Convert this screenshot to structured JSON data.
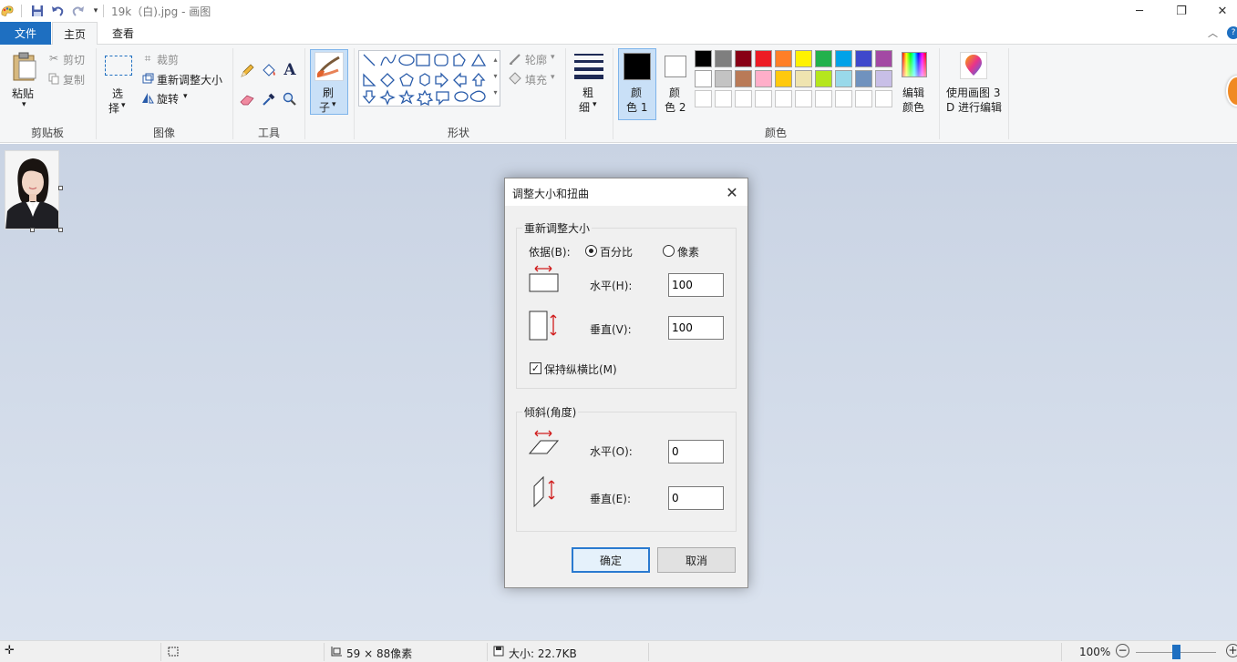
{
  "titlebar": {
    "title": "19k（白).jpg - 画图",
    "icons": [
      "paint-app-icon",
      "save-icon",
      "undo-icon",
      "redo-icon",
      "customize-qat-icon"
    ],
    "controls": {
      "minimize": "─",
      "maximize": "❐",
      "close": "✕"
    }
  },
  "tabs": {
    "file": "文件",
    "home": "主页",
    "view": "查看"
  },
  "ribbon": {
    "clipboard": {
      "paste": "粘贴",
      "cut": "剪切",
      "copy": "复制",
      "group": "剪贴板"
    },
    "image": {
      "select_line1": "选",
      "select_line2": "择",
      "crop": "裁剪",
      "resize": "重新调整大小",
      "rotate": "旋转",
      "group": "图像"
    },
    "tools": {
      "group": "工具",
      "text_glyph": "A"
    },
    "brushes": {
      "line1": "刷",
      "line2": "子"
    },
    "shapes": {
      "outline": "轮廓",
      "fill": "填充",
      "group": "形状"
    },
    "size": {
      "line1": "粗",
      "line2": "细"
    },
    "colors": {
      "color1_line1": "颜",
      "color1_line2": "色 1",
      "color2_line1": "颜",
      "color2_line2": "色 2",
      "edit_line1": "编辑",
      "edit_line2": "颜色",
      "group": "颜色",
      "color1_value": "#000000",
      "color2_value": "#ffffff",
      "palette_row1": [
        "#000000",
        "#7f7f7f",
        "#880015",
        "#ed1c24",
        "#ff7f27",
        "#fff200",
        "#22b14c",
        "#00a2e8",
        "#3f48cc",
        "#a349a4"
      ],
      "palette_row2": [
        "#ffffff",
        "#c3c3c3",
        "#b97a57",
        "#ffaec9",
        "#ffc90e",
        "#efe4b0",
        "#b5e61d",
        "#99d9ea",
        "#7092be",
        "#c8bfe7"
      ]
    },
    "paint3d": {
      "line1": "使用画图 3",
      "line2": "D 进行编辑"
    }
  },
  "dialog": {
    "title": "调整大小和扭曲",
    "resize_legend": "重新调整大小",
    "by_label": "依据(B):",
    "percent_label": "百分比",
    "pixels_label": "像素",
    "percent_selected": true,
    "horizontal_label": "水平(H):",
    "horizontal_value": "100",
    "vertical_label": "垂直(V):",
    "vertical_value": "100",
    "keep_ratio_label": "保持纵横比(M)",
    "keep_ratio_checked": true,
    "skew_legend": "倾斜(角度)",
    "skew_h_label": "水平(O):",
    "skew_h_value": "0",
    "skew_v_label": "垂直(E):",
    "skew_v_value": "0",
    "ok": "确定",
    "cancel": "取消"
  },
  "status": {
    "dimensions": "59 × 88像素",
    "size": "大小: 22.7KB",
    "zoom": "100%",
    "zoom_level_percent": 100
  }
}
